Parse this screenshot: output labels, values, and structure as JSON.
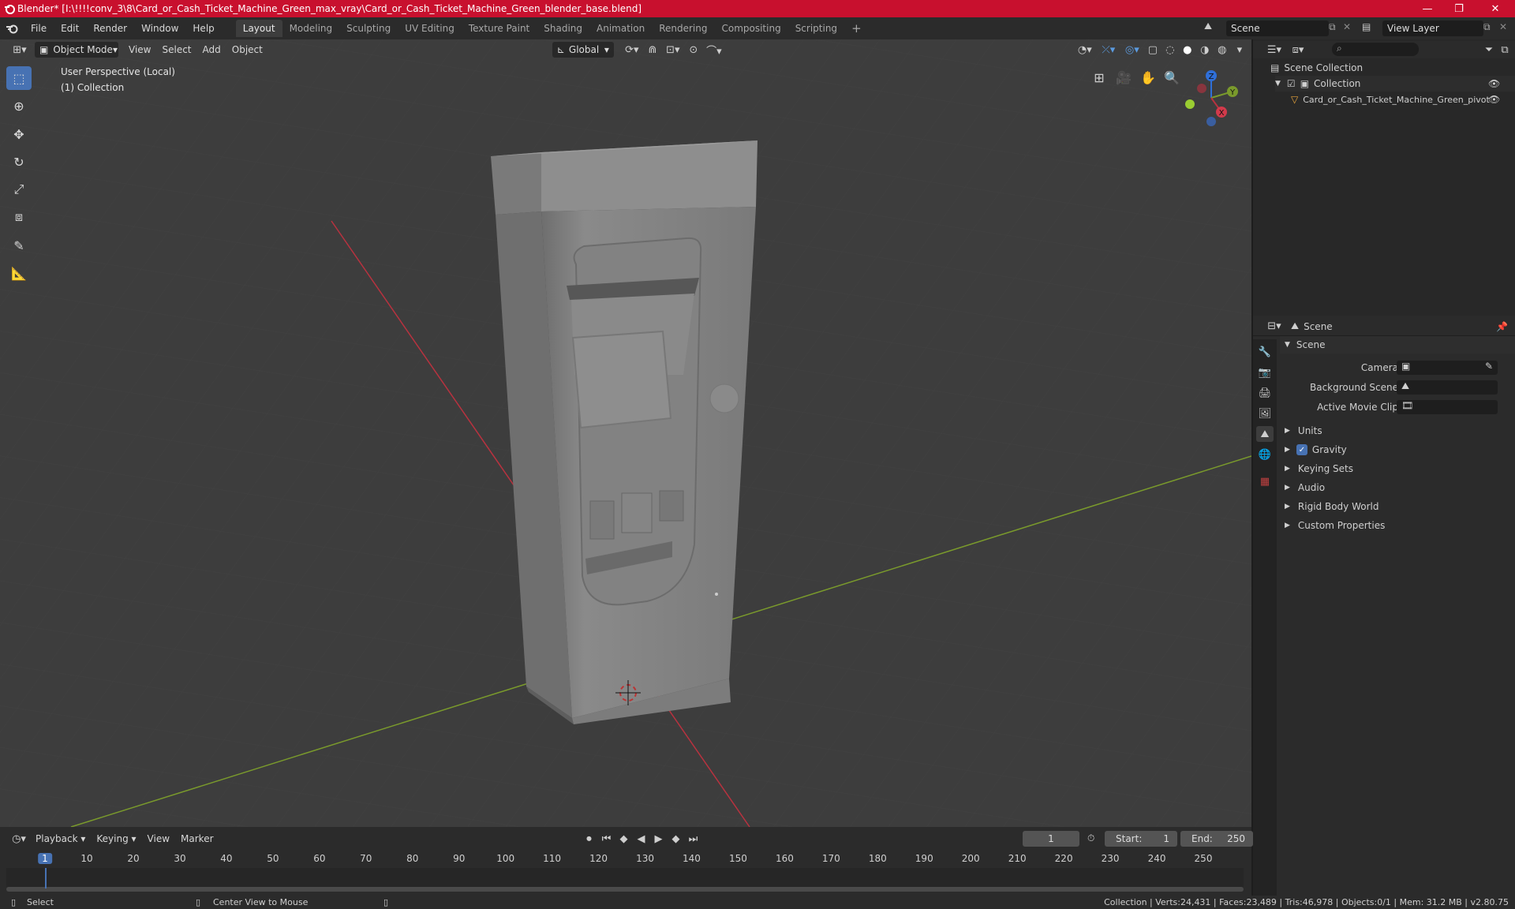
{
  "window": {
    "title": "Blender* [I:\\!!!!conv_3\\8\\Card_or_Cash_Ticket_Machine_Green_max_vray\\Card_or_Cash_Ticket_Machine_Green_blender_base.blend]",
    "minimize": "—",
    "maximize": "❐",
    "close": "✕"
  },
  "menu": {
    "file": "File",
    "edit": "Edit",
    "render": "Render",
    "window": "Window",
    "help": "Help"
  },
  "workspaces": [
    "Layout",
    "Modeling",
    "Sculpting",
    "UV Editing",
    "Texture Paint",
    "Shading",
    "Animation",
    "Rendering",
    "Compositing",
    "Scripting"
  ],
  "add_workspace": "+",
  "scene_selector": {
    "value": "Scene"
  },
  "view_layer_selector": {
    "value": "View Layer"
  },
  "viewport": {
    "mode": "Object Mode",
    "view": "View",
    "select": "Select",
    "add": "Add",
    "object": "Object",
    "orientation": "Global",
    "overlay_title": "User Perspective (Local)",
    "overlay_collection": "(1) Collection",
    "gizmo": {
      "z": "Z",
      "y": "Y",
      "x": "X"
    }
  },
  "outliner": {
    "search_placeholder": "",
    "root": "Scene Collection",
    "collection": "Collection",
    "object": "Card_or_Cash_Ticket_Machine_Green_pivot"
  },
  "properties": {
    "context": "Scene",
    "panel": "Scene",
    "camera_label": "Camera",
    "background_scene_label": "Background Scene",
    "active_movie_clip_label": "Active Movie Clip",
    "sections": [
      "Units",
      "Gravity",
      "Keying Sets",
      "Audio",
      "Rigid Body World",
      "Custom Properties"
    ],
    "gravity_checked": true
  },
  "timeline": {
    "playback": "Playback",
    "keying": "Keying",
    "view": "View",
    "marker": "Marker",
    "current_frame": "1",
    "start_label": "Start:",
    "start": "1",
    "end_label": "End:",
    "end": "250",
    "ticks": [
      "1",
      "10",
      "20",
      "30",
      "40",
      "50",
      "60",
      "70",
      "80",
      "90",
      "100",
      "110",
      "120",
      "130",
      "140",
      "150",
      "160",
      "170",
      "180",
      "190",
      "200",
      "210",
      "220",
      "230",
      "240",
      "250"
    ]
  },
  "status": {
    "select": "Select",
    "center": "Center View to Mouse",
    "stats": "Collection | Verts:24,431 | Faces:23,489 | Tris:46,978 | Objects:0/1 | Mem: 31.2 MB | v2.80.75"
  },
  "colors": {
    "title_bar": "#c8102e",
    "accent": "#4772b3",
    "viewport_bg": "#3d3d3d",
    "x_axis": "#b8323f",
    "y_axis": "#7a9a2c",
    "z_axis": "#2f6fd8"
  }
}
